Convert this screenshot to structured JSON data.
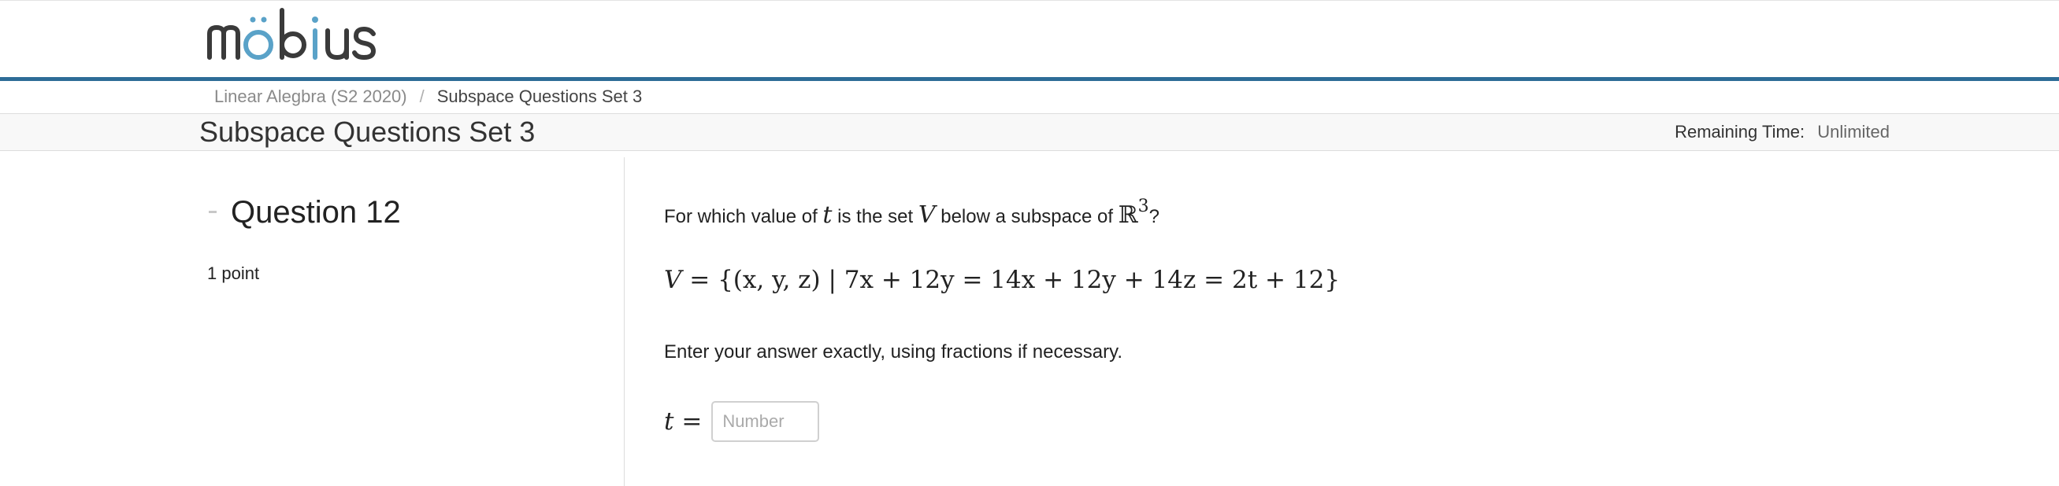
{
  "header": {
    "logo_text": "möbius",
    "accent_color": "#2d6c97"
  },
  "breadcrumb": {
    "course": "Linear Alegbra (S2 2020)",
    "separator": "/",
    "current": "Subspace Questions Set 3"
  },
  "title_bar": {
    "title": "Subspace Questions Set 3",
    "remaining_label": "Remaining Time:",
    "remaining_value": "Unlimited"
  },
  "question": {
    "title": "Question 12",
    "points": "1 point"
  },
  "prompt": {
    "part1": "For which value of ",
    "var_t": "t",
    "part2": " is the set ",
    "var_V": "V",
    "part3": " below a subspace of ",
    "R": "ℝ",
    "exp": "3",
    "part4": "?"
  },
  "equation": {
    "text_lhs": "V",
    "text_rhs": " = {(x, y, z)  |  7x + 12y = 14x + 12y + 14z = 2t + 12}"
  },
  "instruction": "Enter your answer exactly, using fractions if necessary.",
  "answer": {
    "var": "t",
    "eq": " =",
    "placeholder": "Number",
    "value": ""
  }
}
